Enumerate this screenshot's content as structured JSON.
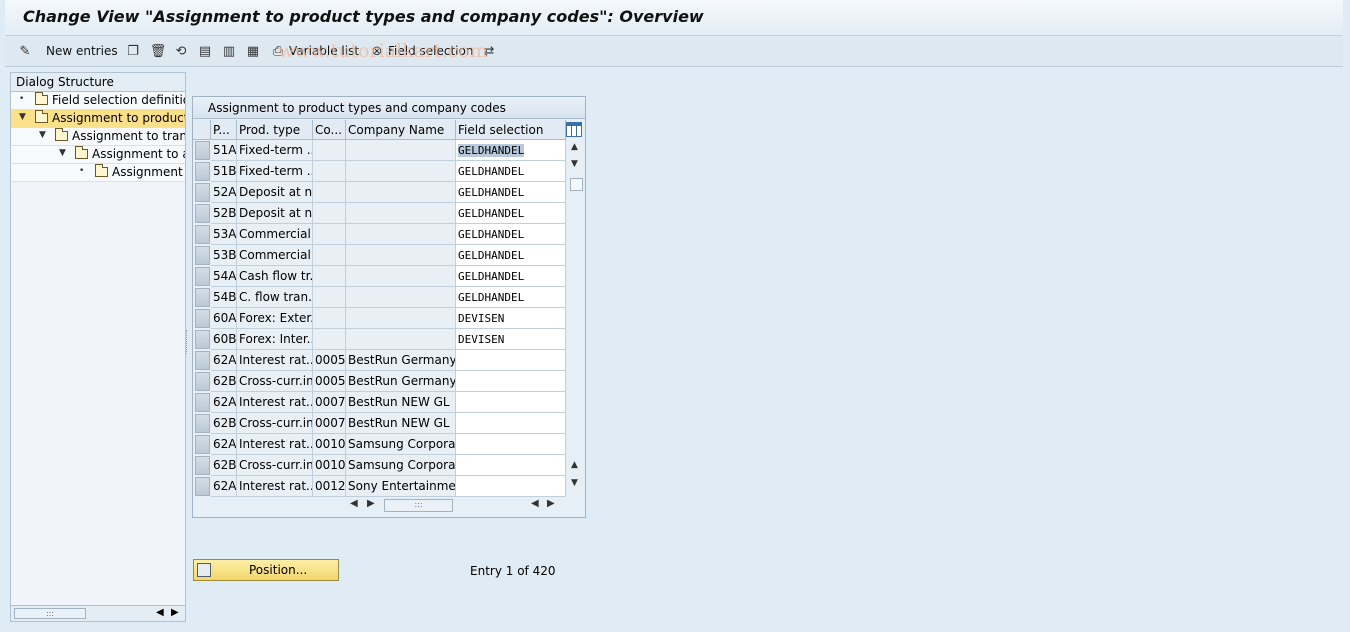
{
  "title": "Change View \"Assignment to product types and company codes\": Overview",
  "watermark": "www.tutorialkart.com",
  "toolbar": {
    "new_entries": "New entries",
    "variable_list": "Variable list",
    "field_selection": "Field selection"
  },
  "dialog": {
    "header": "Dialog Structure",
    "items": [
      {
        "label": "Field selection definition",
        "level": 0,
        "marker": "•",
        "selected": false
      },
      {
        "label": "Assignment to product types and company codes",
        "level": 0,
        "marker": "▼",
        "selected": true
      },
      {
        "label": "Assignment to transaction types",
        "level": 1,
        "marker": "▼",
        "selected": false
      },
      {
        "label": "Assignment to activity categories",
        "level": 2,
        "marker": "▼",
        "selected": false
      },
      {
        "label": "Assignment to field selection",
        "level": 3,
        "marker": "•",
        "selected": false
      }
    ]
  },
  "table": {
    "title": "Assignment to product types and company codes",
    "headers": {
      "p": "P...",
      "prod_type": "Prod. type",
      "co": "Co...",
      "company_name": "Company Name",
      "field_selection": "Field selection"
    },
    "rows": [
      {
        "p": "51A",
        "prod": "Fixed-term ...",
        "co": "",
        "name": "",
        "fs": "GELDHANDEL"
      },
      {
        "p": "51B",
        "prod": "Fixed-term ...",
        "co": "",
        "name": "",
        "fs": "GELDHANDEL"
      },
      {
        "p": "52A",
        "prod": "Deposit at n...",
        "co": "",
        "name": "",
        "fs": "GELDHANDEL"
      },
      {
        "p": "52B",
        "prod": "Deposit at n...",
        "co": "",
        "name": "",
        "fs": "GELDHANDEL"
      },
      {
        "p": "53A",
        "prod": "Commercial ...",
        "co": "",
        "name": "",
        "fs": "GELDHANDEL"
      },
      {
        "p": "53B",
        "prod": "Commercial ...",
        "co": "",
        "name": "",
        "fs": "GELDHANDEL"
      },
      {
        "p": "54A",
        "prod": "Cash flow tr...",
        "co": "",
        "name": "",
        "fs": "GELDHANDEL"
      },
      {
        "p": "54B",
        "prod": "C. flow tran...",
        "co": "",
        "name": "",
        "fs": "GELDHANDEL"
      },
      {
        "p": "60A",
        "prod": "Forex: Exter...",
        "co": "",
        "name": "",
        "fs": "DEVISEN"
      },
      {
        "p": "60B",
        "prod": "Forex: Inter...",
        "co": "",
        "name": "",
        "fs": "DEVISEN"
      },
      {
        "p": "62A",
        "prod": "Interest rat...",
        "co": "0005",
        "name": "BestRun Germany ...",
        "fs": ""
      },
      {
        "p": "62B",
        "prod": "Cross-curr.in...",
        "co": "0005",
        "name": "BestRun Germany ...",
        "fs": ""
      },
      {
        "p": "62A",
        "prod": "Interest rat...",
        "co": "0007",
        "name": "BestRun NEW GL",
        "fs": ""
      },
      {
        "p": "62B",
        "prod": "Cross-curr.in...",
        "co": "0007",
        "name": "BestRun NEW GL",
        "fs": ""
      },
      {
        "p": "62A",
        "prod": "Interest rat...",
        "co": "0010",
        "name": "Samsung Corporati...",
        "fs": ""
      },
      {
        "p": "62B",
        "prod": "Cross-curr.in...",
        "co": "0010",
        "name": "Samsung Corporati...",
        "fs": ""
      },
      {
        "p": "62A",
        "prod": "Interest rat...",
        "co": "0012",
        "name": "Sony Entertainme...",
        "fs": ""
      }
    ]
  },
  "position_button": "Position...",
  "entry_info": "Entry 1 of 420"
}
